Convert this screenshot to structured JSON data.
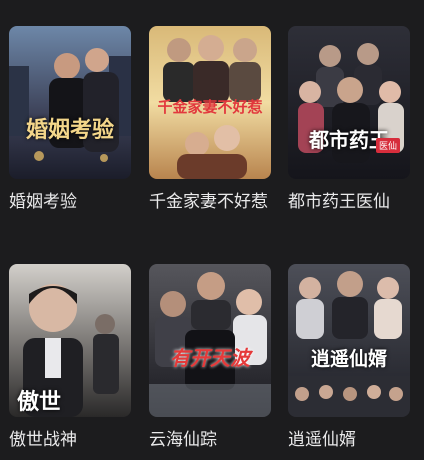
{
  "dramas": [
    {
      "title": "婚姻考验",
      "poster_text": "婚姻考验",
      "poster_text_color": "#f3d68a"
    },
    {
      "title": "千金家妻不好惹",
      "poster_text": "千金家妻不好惹",
      "poster_text_color": "#e2383d"
    },
    {
      "title": "都市药王医仙",
      "poster_text": "都市药王",
      "poster_badge": "医仙",
      "poster_text_color": "#ffffff"
    },
    {
      "title": "傲世战神",
      "poster_text": "傲世",
      "poster_text_color": "#ffffff"
    },
    {
      "title": "云海仙踪",
      "poster_text": "有开天波",
      "poster_text_color": "#e53a3a"
    },
    {
      "title": "逍遥仙婿",
      "poster_text": "逍遥仙婿",
      "poster_text_color": "#ffffff"
    }
  ]
}
